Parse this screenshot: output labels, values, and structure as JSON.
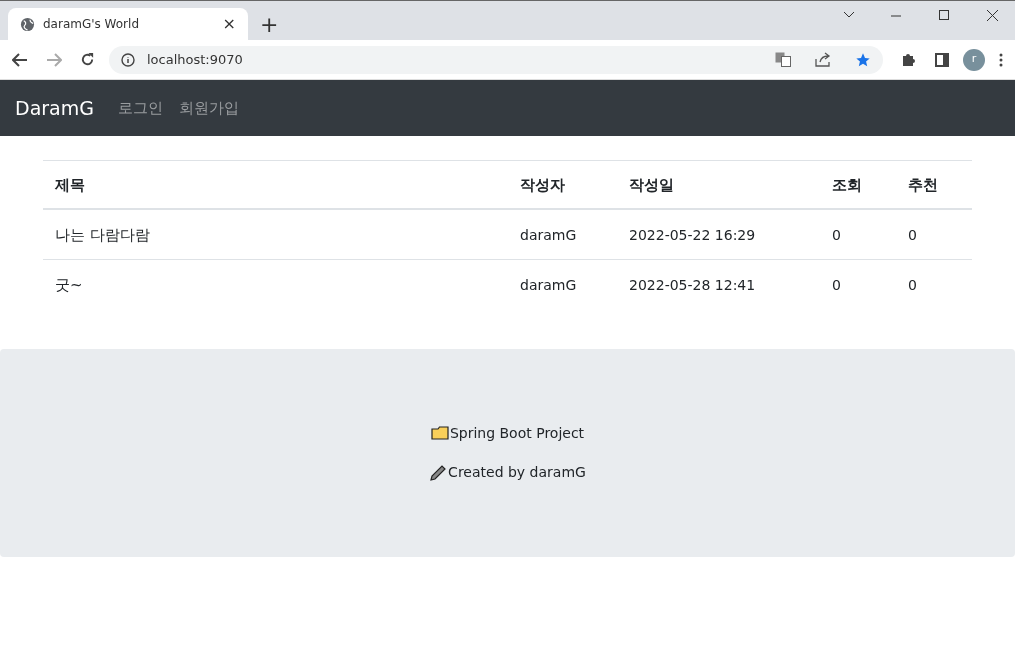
{
  "browser": {
    "tab_title": "daramG's World",
    "close": "×",
    "new_tab": "+",
    "address": "localhost:9070",
    "avatar": "r"
  },
  "navbar": {
    "brand": "DaramG",
    "links": [
      "로그인",
      "회원가입"
    ]
  },
  "table": {
    "columns": [
      "제목",
      "작성자",
      "작성일",
      "조회",
      "추천"
    ],
    "rows": [
      [
        "나는 다람다람",
        "daramG",
        "2022-05-22 16:29",
        "0",
        "0"
      ],
      [
        "굿~",
        "daramG",
        "2022-05-28 12:41",
        "0",
        "0"
      ]
    ]
  },
  "footer": {
    "lines": [
      {
        "kind": "folder",
        "text": "Spring Boot Project"
      },
      {
        "kind": "pencil",
        "text": "Created by daramG"
      }
    ]
  }
}
